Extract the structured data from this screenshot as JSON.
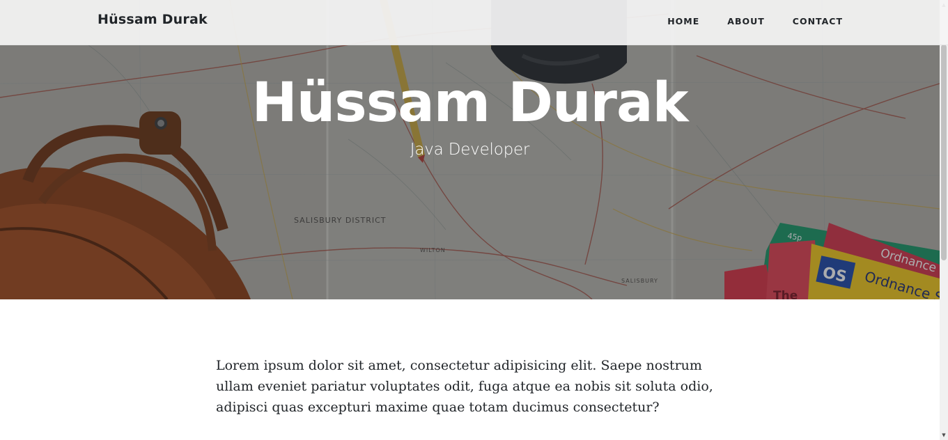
{
  "navbar": {
    "brand": "Hüssam Durak",
    "links": [
      {
        "label": "HOME"
      },
      {
        "label": "ABOUT"
      },
      {
        "label": "CONTACT"
      }
    ]
  },
  "hero": {
    "title": "Hüssam Durak",
    "subtitle": "Java Developer",
    "map_labels": [
      "SALISBURY DISTRICT",
      "WILTON",
      "SALISBURY"
    ],
    "map_books": [
      "Ordnance Survey",
      "Ordnance",
      "OS",
      "45p",
      "The"
    ]
  },
  "content": {
    "paragraph": "Lorem ipsum dolor sit amet, consectetur adipisicing elit. Saepe nostrum ullam eveniet pariatur voluptates odit, fuga atque ea nobis sit soluta odio, adipisci quas excepturi maxime quae totam ducimus consectetur?"
  },
  "colors": {
    "text": "#212529",
    "overlay": "#212529",
    "navbar_bg": "#f5f5f5",
    "bag": "#9a4a1e",
    "book_red": "#d32f3f",
    "book_yellow": "#f2c81c",
    "book_green": "#1a9a6a"
  }
}
